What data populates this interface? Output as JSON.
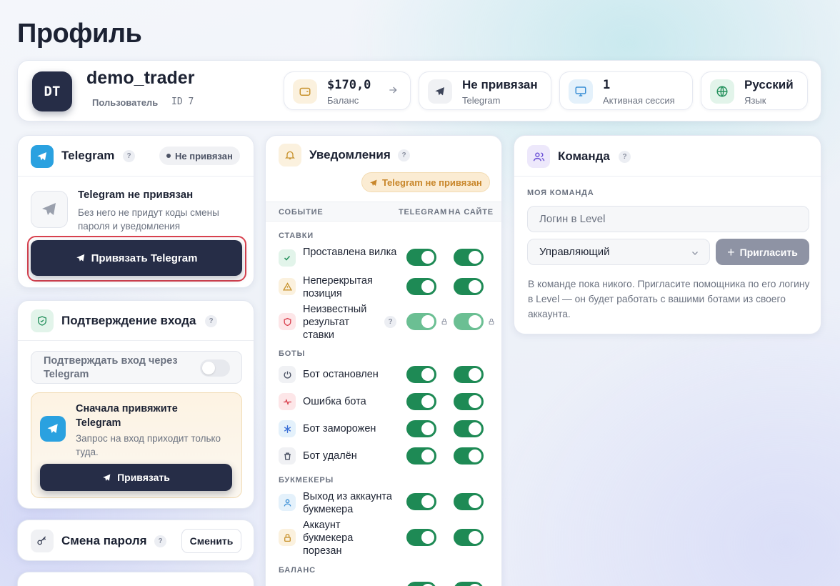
{
  "page": {
    "title": "Профиль"
  },
  "profile": {
    "initials": "DT",
    "username": "demo_trader",
    "role": "Пользователь",
    "id": "ID 7",
    "stats": [
      {
        "value": "$170,0",
        "label": "Баланс",
        "icon": "wallet-icon"
      },
      {
        "value": "Не привязан",
        "label": "Telegram",
        "icon": "telegram-icon"
      },
      {
        "value": "1",
        "label": "Активная сессия",
        "icon": "monitor-icon"
      },
      {
        "value": "Русский",
        "label": "Язык",
        "icon": "globe-icon"
      }
    ]
  },
  "telegram_card": {
    "title": "Telegram",
    "status": "Не привязан",
    "empty_title": "Telegram не привязан",
    "empty_desc": "Без него не придут коды смены пароля и уведомления",
    "link_button": "Привязать Telegram"
  },
  "login_confirm": {
    "title": "Подтверждение входа",
    "toggle_label": "Подтверждать вход через Telegram",
    "toggle_on": false,
    "notice_title": "Сначала привяжите Telegram",
    "notice_desc": "Запрос на вход приходит только туда.",
    "notice_button": "Привязать"
  },
  "password": {
    "title": "Смена пароля",
    "button": "Сменить"
  },
  "notifications": {
    "title": "Уведомления",
    "badge": "Telegram не привязан",
    "col_event": "СОБЫТИЕ",
    "col_telegram": "TELEGRAM",
    "col_site": "НА САЙТЕ",
    "sections": [
      {
        "name": "СТАВКИ",
        "items": [
          {
            "label": "Проставлена вилка",
            "telegram": true,
            "site": true,
            "icon": "check-icon"
          },
          {
            "label": "Неперекрытая позиция",
            "telegram": true,
            "site": true,
            "icon": "warning-icon"
          },
          {
            "label": "Неизвестный результат ставки",
            "telegram": true,
            "site": true,
            "locked": true,
            "icon": "shield-icon"
          }
        ]
      },
      {
        "name": "БОТЫ",
        "items": [
          {
            "label": "Бот остановлен",
            "telegram": true,
            "site": true,
            "icon": "power-icon"
          },
          {
            "label": "Ошибка бота",
            "telegram": true,
            "site": true,
            "icon": "pulse-icon"
          },
          {
            "label": "Бот заморожен",
            "telegram": true,
            "site": true,
            "icon": "snowflake-icon"
          },
          {
            "label": "Бот удалён",
            "telegram": true,
            "site": true,
            "icon": "trash-icon"
          }
        ]
      },
      {
        "name": "БУКМЕКЕРЫ",
        "items": [
          {
            "label": "Выход из аккаунта букмекера",
            "telegram": true,
            "site": true,
            "icon": "user-icon"
          },
          {
            "label": "Аккаунт букмекера порезан",
            "telegram": true,
            "site": true,
            "icon": "lock-icon"
          }
        ]
      },
      {
        "name": "БАЛАНС",
        "items": []
      }
    ]
  },
  "team": {
    "title": "Команда",
    "section": "МОЯ КОМАНДА",
    "login_placeholder": "Логин в Level",
    "role_value": "Управляющий",
    "invite_button": "Пригласить",
    "empty_text": "В команде пока никого. Пригласите помощника по его логину в Level — он будет работать с вашими ботами из своего аккаунта."
  },
  "colors": {
    "accent": "#262d47",
    "toggle_on": "#1e8a55",
    "highlight": "#d9414e",
    "telegram": "#2aa1e0"
  }
}
